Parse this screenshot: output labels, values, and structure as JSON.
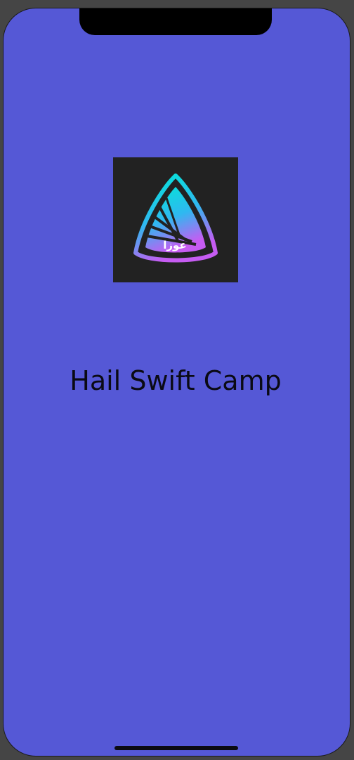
{
  "app": {
    "title": "Hail Swift Camp",
    "logo_name": "swift-camp-logo",
    "logo_text": "عوزا"
  },
  "colors": {
    "screen_background": "#5558d6",
    "device_frame": "#454545",
    "logo_background": "#222222",
    "logo_gradient_top": "#00e5d8",
    "logo_gradient_bottom": "#c05cf0",
    "title_text": "#0a0a14"
  }
}
